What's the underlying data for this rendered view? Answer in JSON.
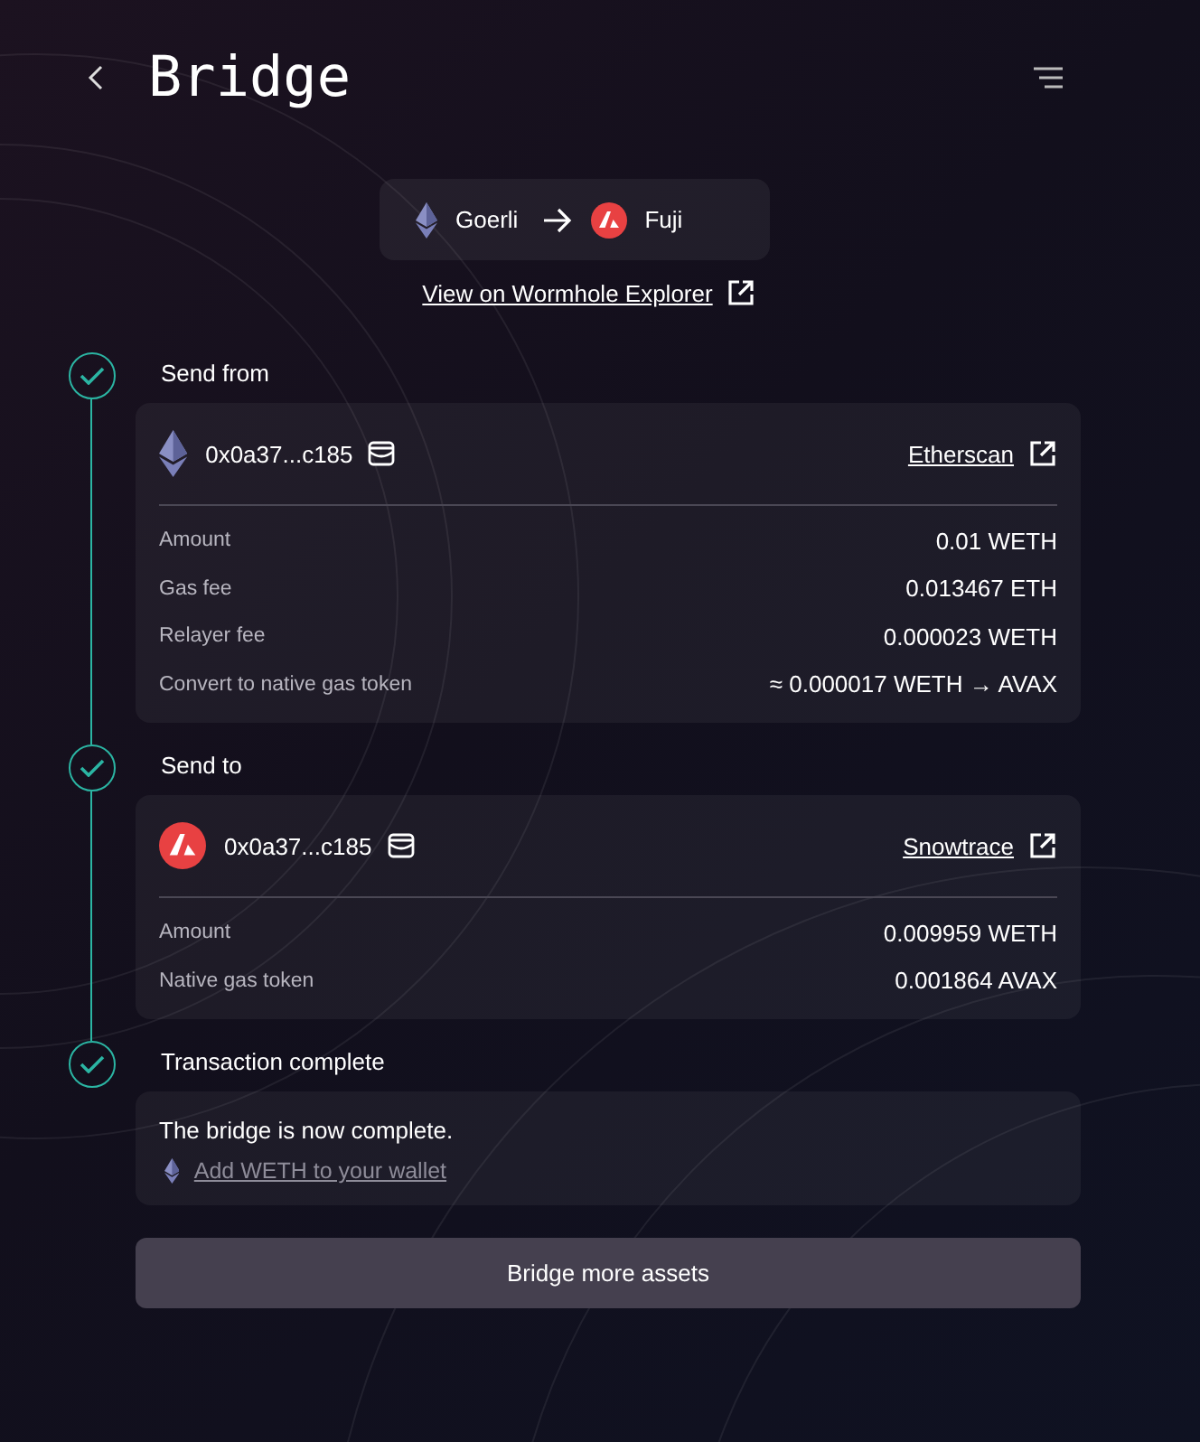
{
  "header": {
    "title": "Bridge"
  },
  "route": {
    "from": {
      "kind": "eth",
      "name": "Goerli"
    },
    "to": {
      "kind": "avax",
      "name": "Fuji"
    }
  },
  "explorer_link": "View on Wormhole Explorer",
  "steps": [
    {
      "kind": "transfer",
      "title": "Send from",
      "done": true,
      "wallet": {
        "kind": "eth",
        "address": "0x0a37...c185"
      },
      "explorer": "Etherscan",
      "rows": [
        {
          "label": "Amount",
          "value": "0.01 WETH"
        },
        {
          "label": "Gas fee",
          "value": "0.013467 ETH"
        },
        {
          "label": "Relayer fee",
          "value": "0.000023 WETH"
        },
        {
          "label": "Convert to native gas token",
          "value": "≈ 0.000017 WETH → AVAX"
        }
      ]
    },
    {
      "kind": "transfer",
      "title": "Send to",
      "done": true,
      "wallet": {
        "kind": "avax",
        "address": "0x0a37...c185"
      },
      "explorer": "Snowtrace",
      "rows": [
        {
          "label": "Amount",
          "value": "0.009959 WETH"
        },
        {
          "label": "Native gas token",
          "value": "0.001864 AVAX"
        }
      ]
    },
    {
      "kind": "message",
      "title": "Transaction complete",
      "done": true,
      "message": "The bridge is now complete.",
      "link": {
        "kind": "eth",
        "text": "Add WETH to your wallet"
      }
    }
  ],
  "button": "Bridge more assets"
}
